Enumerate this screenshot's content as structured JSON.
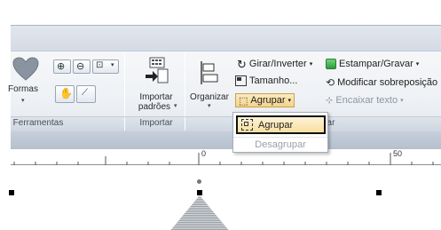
{
  "ribbon": {
    "groups": {
      "ferramentas": "Ferramentas",
      "importar": "Importar",
      "organizar_partial": "ar"
    },
    "formas_label": "Formas",
    "importar_label_1": "Importar",
    "importar_label_2": "padrões",
    "organizar_label": "Organizar",
    "girar_label": "Girar/Inverter",
    "tamanho_label": "Tamanho...",
    "agrupar_label": "Agrupar",
    "estampar_label": "Estampar/Gravar",
    "modificar_label": "Modificar sobreposição",
    "encaixar_label": "Encaixar texto"
  },
  "dropdown": {
    "agrupar": "Agrupar",
    "desagrupar": "Desagrupar"
  },
  "ruler": {
    "tick_0": "0",
    "tick_50": "50"
  },
  "colors": {
    "accent_green": "#3cb34a",
    "heart_gray": "#8a93a0",
    "highlight": "#f8dfa1"
  }
}
